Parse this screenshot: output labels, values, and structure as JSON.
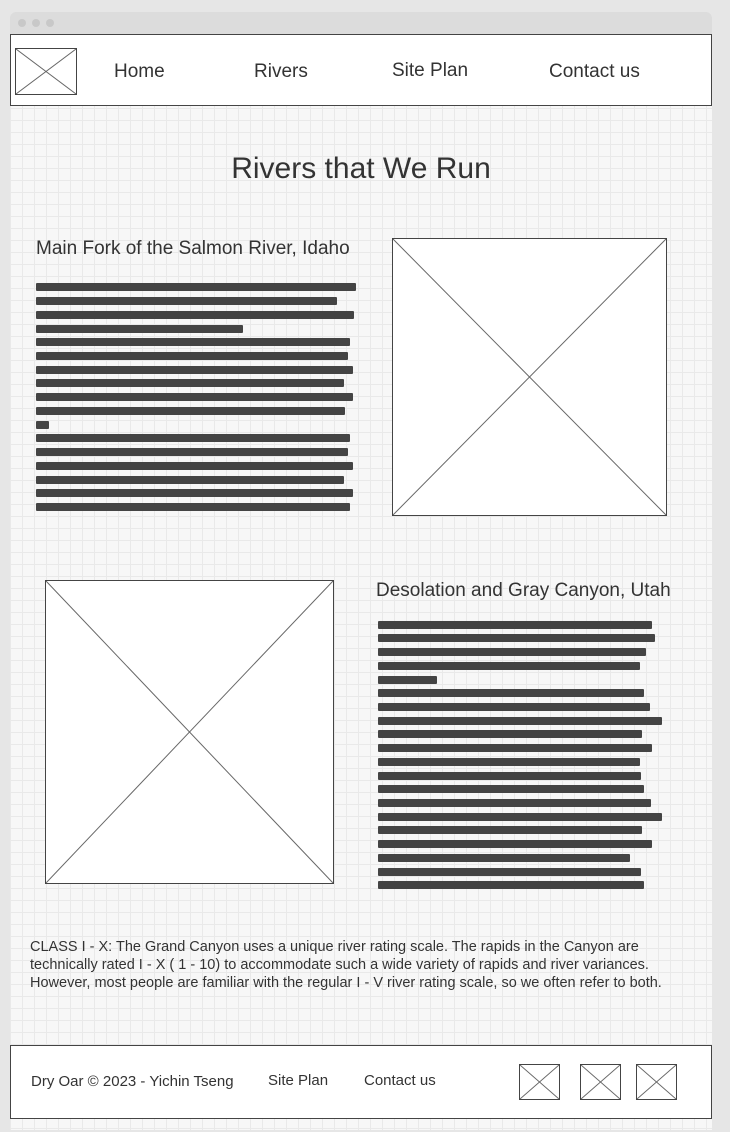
{
  "nav": {
    "items": [
      {
        "label": "Home"
      },
      {
        "label": "Rivers"
      },
      {
        "label": "Site Plan"
      },
      {
        "label": "Contact us"
      }
    ]
  },
  "main": {
    "title": "Rivers that We Run",
    "sections": [
      {
        "heading": "Main Fork of the Salmon River, Idaho"
      },
      {
        "heading": "Desolation and Gray Canyon, Utah"
      }
    ],
    "note": "CLASS I - X: The Grand Canyon uses a unique river rating scale. The rapids in the Canyon are technically rated I - X ( 1 - 10) to accommodate such a wide variety of rapids and river variances. However, most people are familiar with the regular I - V river rating scale, so we often refer to both."
  },
  "footer": {
    "copyright": "Dry Oar © 2023 - Yichin Tseng",
    "site_plan": "Site Plan",
    "contact": "Contact us"
  }
}
